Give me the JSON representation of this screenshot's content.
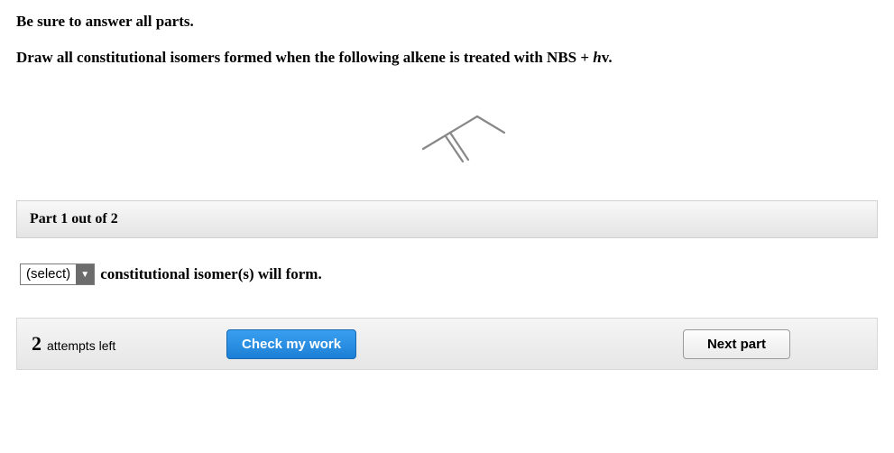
{
  "instruction": "Be sure to answer all parts.",
  "question_prefix": "Draw all constitutional isomers formed when the following alkene is treated with NBS + ",
  "question_hv": "h",
  "question_nu": "v",
  "question_suffix": ".",
  "part_header": "Part 1 out of 2",
  "select_placeholder": "(select)",
  "answer_text": " constitutional isomer(s) will form.",
  "attempts": {
    "count": "2",
    "label": "attempts left"
  },
  "buttons": {
    "check": "Check my work",
    "next": "Next part"
  }
}
